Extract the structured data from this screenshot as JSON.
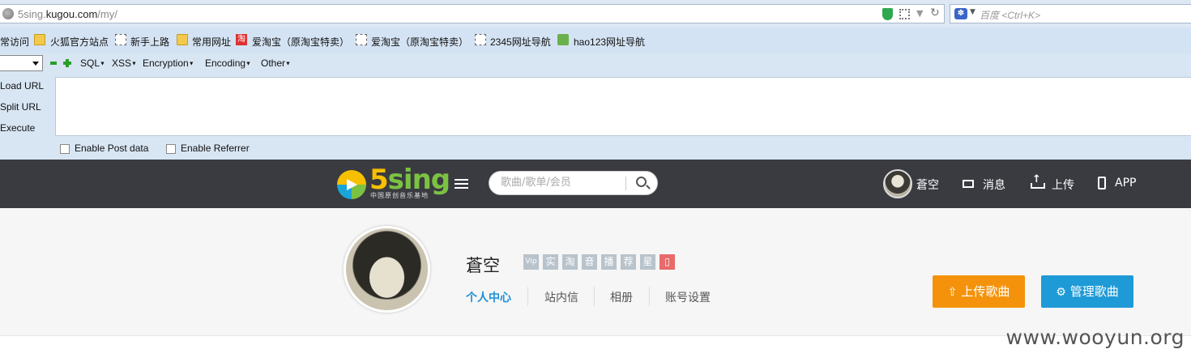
{
  "browser": {
    "url_prefix": "5sing.",
    "url_domain": "kugou.com",
    "url_path": "/my/",
    "search_placeholder": "百度 <Ctrl+K>",
    "search_engine_icon": "baidu-paw-icon"
  },
  "bookmarks": [
    {
      "label": "常访问",
      "icon": "none"
    },
    {
      "label": "火狐官方站点",
      "icon": "folder-icon"
    },
    {
      "label": "新手上路",
      "icon": "dashed-page-icon"
    },
    {
      "label": "常用网址",
      "icon": "folder-icon"
    },
    {
      "label": "爱淘宝（原淘宝特卖）",
      "icon": "taobao-icon"
    },
    {
      "label": "爱淘宝（原淘宝特卖）",
      "icon": "dashed-page-icon"
    },
    {
      "label": "2345网址导航",
      "icon": "dashed-page-icon"
    },
    {
      "label": "hao123网址导航",
      "icon": "hao123-icon"
    }
  ],
  "hackbar": {
    "menus": [
      "SQL",
      "XSS",
      "Encryption",
      "Encoding",
      "Other"
    ],
    "load_url": "Load URL",
    "split_url": "Split URL",
    "execute": "Execute",
    "enable_post": "Enable Post data",
    "enable_referrer": "Enable Referrer",
    "textarea_value": ""
  },
  "site": {
    "logo_text_a": "5",
    "logo_text_b": "sing",
    "logo_sub": "中国原创音乐基地",
    "search_placeholder": "歌曲/歌单/会员",
    "user_name": "蒼空",
    "messages": "消息",
    "upload": "上传",
    "app": "APP"
  },
  "profile": {
    "name": "蒼空",
    "badges": [
      "Vip",
      "实",
      "淘",
      "音",
      "播",
      "荐",
      "星"
    ],
    "tabs": [
      "个人中心",
      "站内信",
      "相册",
      "账号设置"
    ],
    "active_tab": 0,
    "upload_button": "上传歌曲",
    "manage_button": "管理歌曲"
  },
  "watermark": "www.wooyun.org",
  "colors": {
    "nav_bg": "#3a3b41",
    "active_tab": "#1e8fd6",
    "upload_btn": "#f4930b",
    "manage_btn": "#1e9ad6"
  }
}
